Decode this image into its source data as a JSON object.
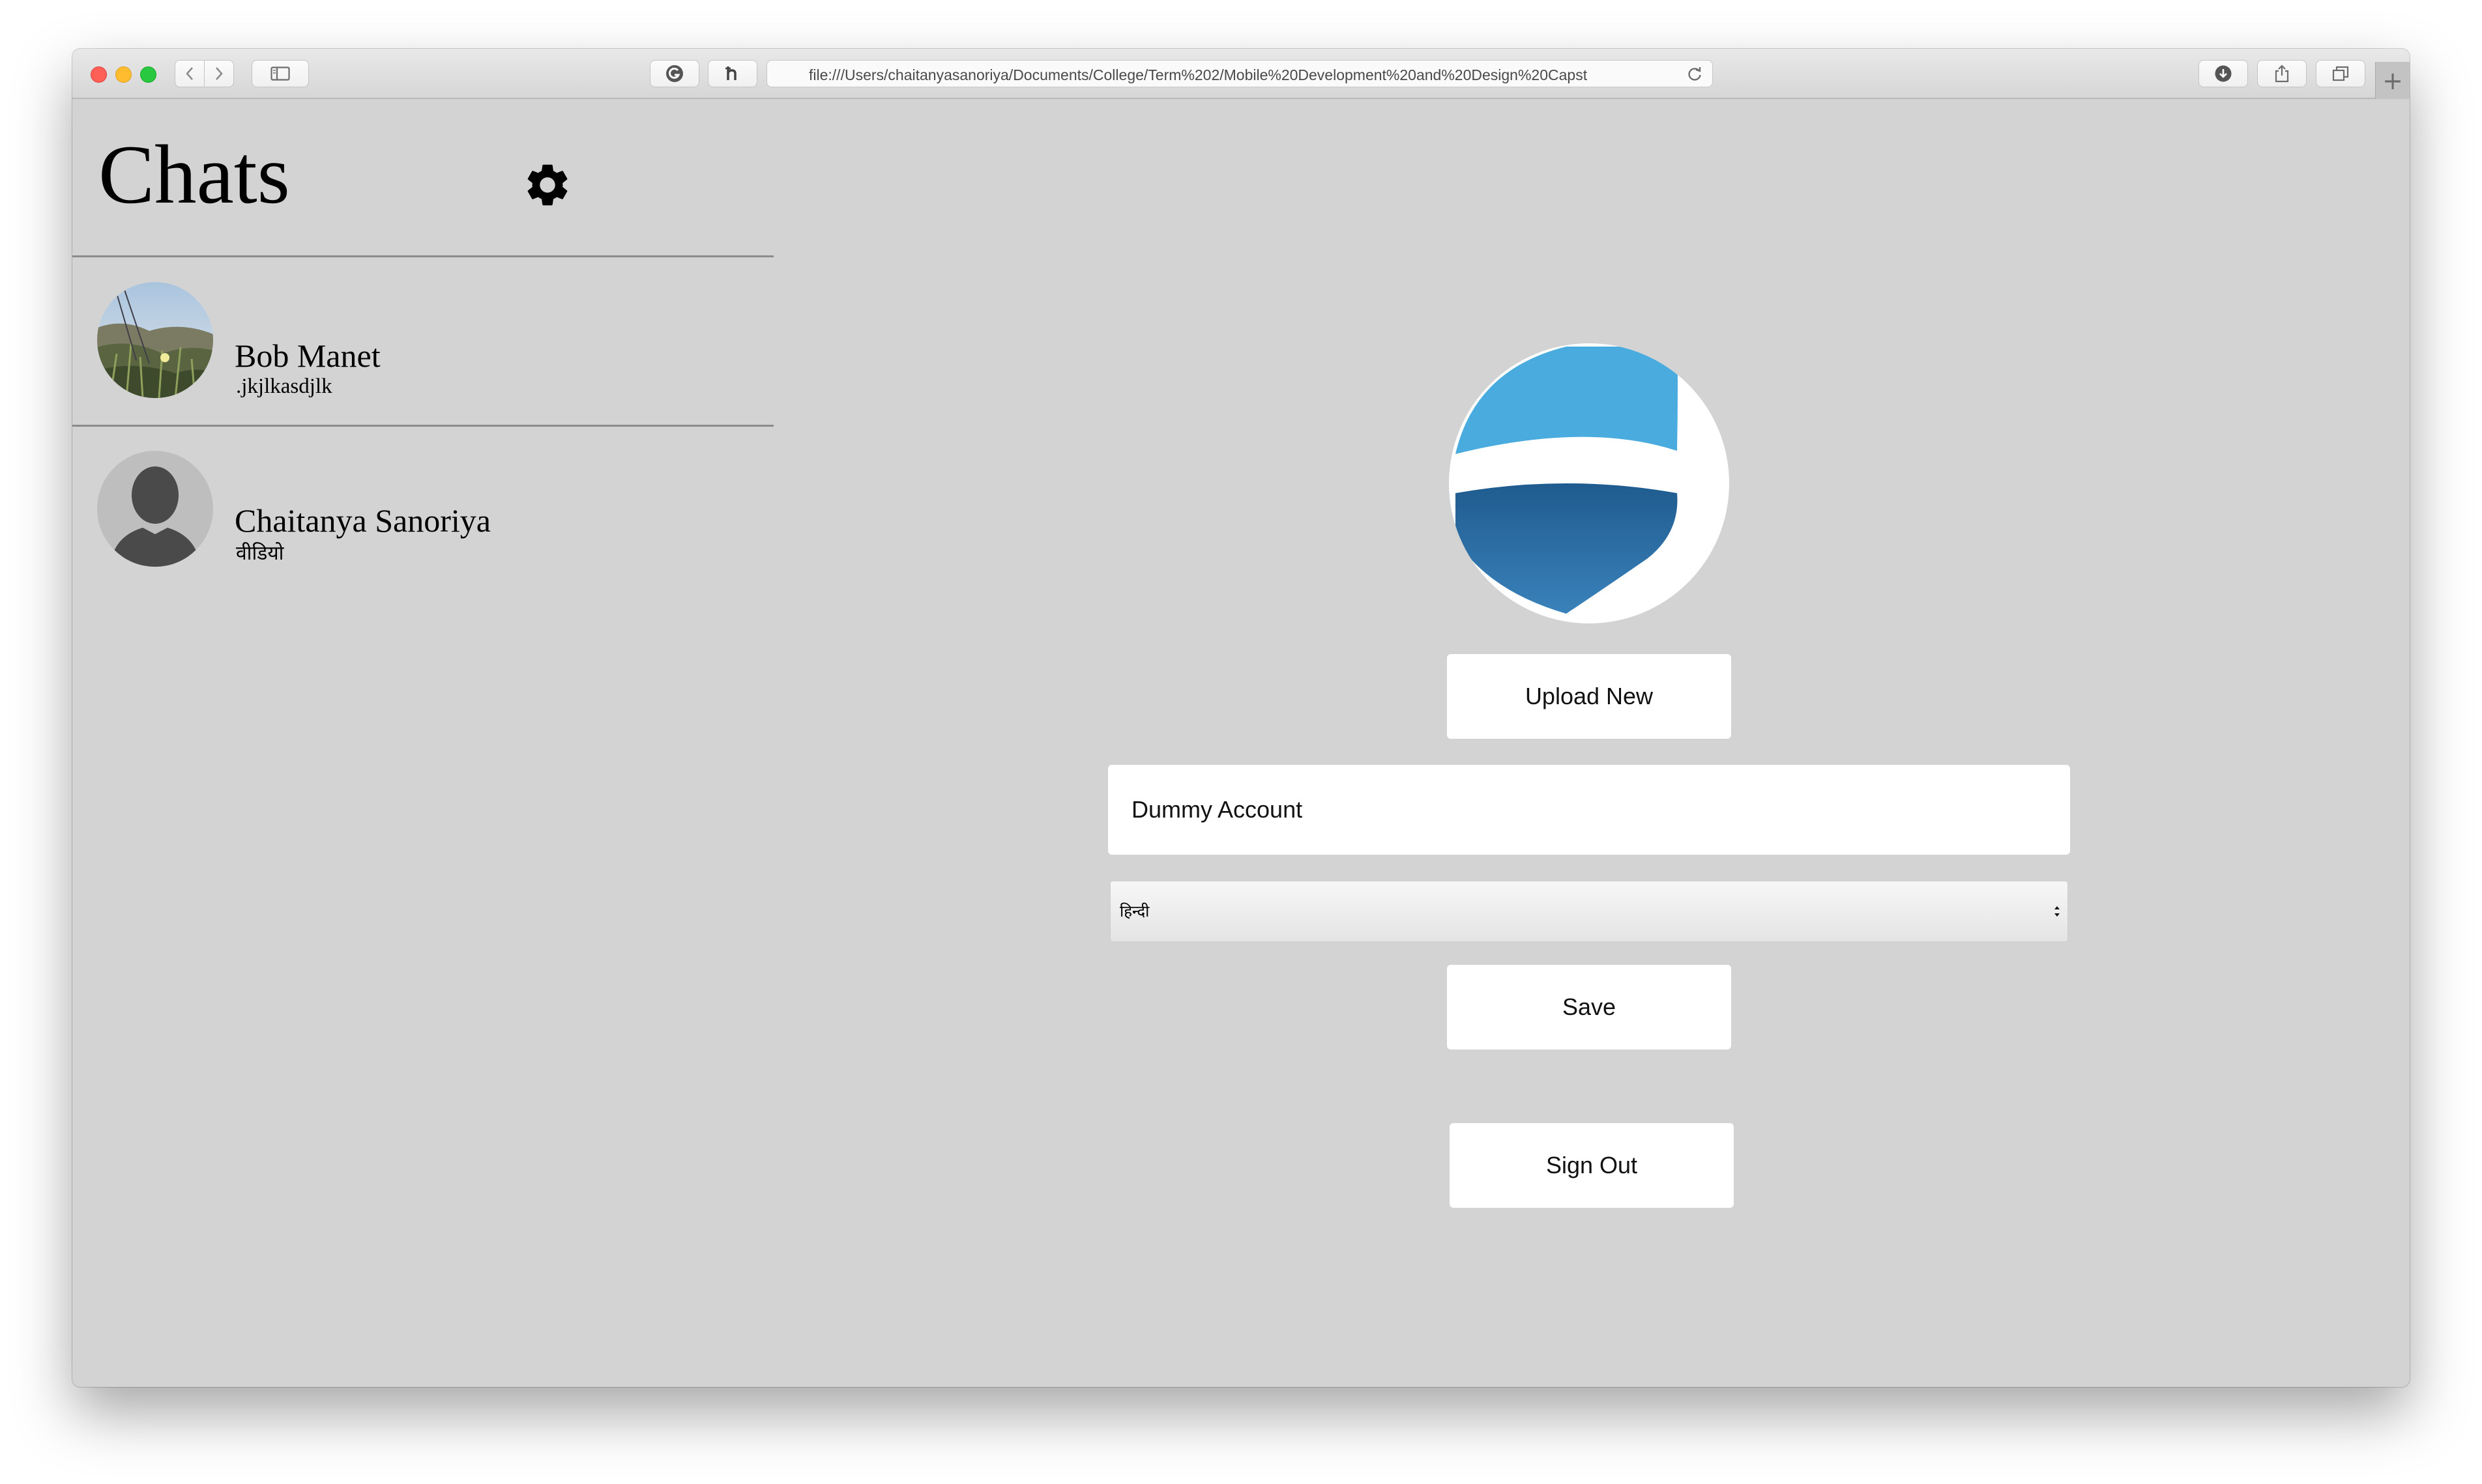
{
  "browser": {
    "url": "file:///Users/chaitanyasanoriya/Documents/College/Term%202/Mobile%20Development%20and%20Design%20Capst",
    "new_tab_symbol": "+",
    "traffic_light_colors": {
      "close": "#fe5f57",
      "minimize": "#febc2e",
      "zoom": "#28c840"
    },
    "icons": [
      "chevron-left-icon",
      "chevron-right-icon",
      "sidebar-icon",
      "grammarly-icon",
      "hypothesis-icon",
      "reload-icon",
      "download-icon",
      "share-icon",
      "tabs-icon"
    ]
  },
  "sidebar": {
    "title": "Chats",
    "settings_icon": "gear-icon",
    "chats": [
      {
        "name": "Bob Manet",
        "last_message": ".jkjlkasdjlk",
        "avatar": "landscape-photo"
      },
      {
        "name": "Chaitanya Sanoriya",
        "last_message": "वीडियो",
        "avatar": "default-person-silhouette"
      }
    ]
  },
  "profile": {
    "picture": "blue-white-shield-logo",
    "upload_label": "Upload New",
    "display_name": "Dummy Account",
    "language_selected": "हिन्दी",
    "save_label": "Save",
    "sign_out_label": "Sign Out"
  },
  "colors": {
    "background": "#d3d3d3",
    "button_bg": "#ffffff",
    "logo_light_blue": "#4aabdf",
    "logo_dark_blue": "#2a6fa8"
  }
}
